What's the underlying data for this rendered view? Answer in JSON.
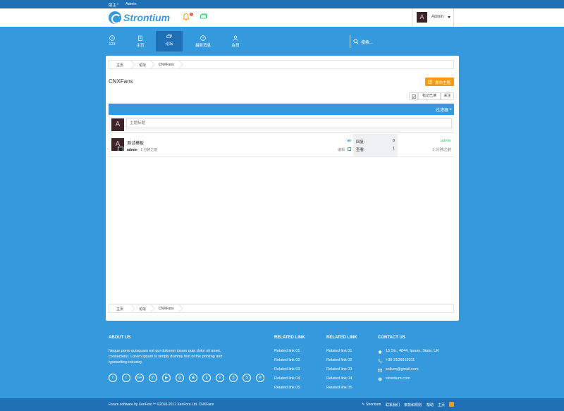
{
  "topbar": {
    "lang": "版主",
    "user": "Admin"
  },
  "header": {
    "logo_text": "Strontium",
    "notification_count": "3",
    "username": "Admin",
    "avatar_letter": "A"
  },
  "nav": {
    "items": [
      {
        "label": "123",
        "icon": "question-circle-icon"
      },
      {
        "label": "主页",
        "icon": "home-icon"
      },
      {
        "label": "论坛",
        "icon": "chat-bubbles-icon",
        "active": true
      },
      {
        "label": "最新消息",
        "icon": "question-circle-icon"
      },
      {
        "label": "会员",
        "icon": "user-icon"
      }
    ],
    "search_label": "搜索..."
  },
  "breadcrumb": [
    "主页",
    "论坛",
    "CNXFans"
  ],
  "page": {
    "title": "CNXFans",
    "post_button": "发布主题"
  },
  "actions": {
    "mark_read": "标记已读",
    "follow": "关注"
  },
  "filter": {
    "label": "过滤器"
  },
  "new_thread": {
    "placeholder": "主题标题"
  },
  "threads": [
    {
      "title": "测试模板",
      "author": "admin",
      "time": "1 分钟之前",
      "edit_label": "编辑",
      "replies_label": "回复:",
      "replies": "0",
      "views_label": "查看:",
      "views": "1",
      "last_user": "admin",
      "last_time": "1 分钟之前"
    }
  ],
  "footer": {
    "about_title": "ABOUT US",
    "about_text": "Neque porro quisquam est qui dolorem ipsum quia dolor sit amet, consectetur. Lorem Ipsum is simply dummy text of the printing and typesetting industry.",
    "related_title_1": "RELATED LINK",
    "related_links_1": [
      "Related link 01",
      "Related link 02",
      "Related link 03",
      "Related link 04",
      "Related link 05"
    ],
    "related_title_2": "RELATED LINK",
    "related_links_2": [
      "Related link 01",
      "Related link 02",
      "Related link 03",
      "Related link 04",
      "Related link 05"
    ],
    "contact_title": "CONTACT US",
    "contact": {
      "address": "15 Str., 4844, Ipsum, State, UK",
      "phone": "+30-2106019311",
      "email": "solium@gmail.com",
      "website": "strontium.com"
    },
    "social_icons": [
      "facebook-icon",
      "twitter-icon",
      "google-plus-icon",
      "linkedin-icon",
      "youtube-icon",
      "dribbble-icon",
      "instagram-icon",
      "pinterest-icon",
      "vimeo-icon",
      "rss-icon",
      "skype-icon",
      "email-icon"
    ]
  },
  "bottombar": {
    "copyright": "Forum software by XenForo™ ©2010-2017 XenForo Ltd. CNXFans",
    "brand": "Strontium",
    "links": [
      "联系我们",
      "条款和规则",
      "帮助",
      "主页"
    ]
  },
  "colors": {
    "primary": "#3599de",
    "dark": "#1e6fb4",
    "accent": "#f39c12",
    "green": "#2ecc71"
  }
}
